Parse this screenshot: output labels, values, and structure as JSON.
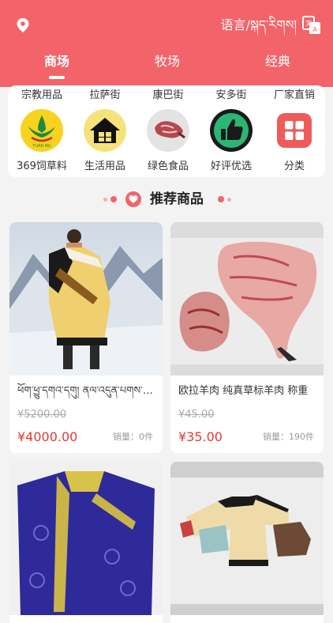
{
  "header": {
    "language_label": "语言/སྐད་རིགས།",
    "tabs": [
      {
        "label": "商场",
        "active": true
      },
      {
        "label": "牧场",
        "active": false
      },
      {
        "label": "经典",
        "active": false
      }
    ],
    "accent_color": "#f2646a"
  },
  "streets": [
    "宗教用品",
    "拉萨街",
    "康巴街",
    "安多街",
    "厂家直销"
  ],
  "categories": [
    {
      "label": "369饲草料",
      "icon": "yuan-mu-logo-icon",
      "logo_caption": "YUAN MU"
    },
    {
      "label": "生活用品",
      "icon": "house-icon"
    },
    {
      "label": "绿色食品",
      "icon": "meat-icon"
    },
    {
      "label": "好评优选",
      "icon": "thumbs-up-icon"
    },
    {
      "label": "分类",
      "icon": "grid-icon"
    }
  ],
  "section": {
    "title": "推荐商品"
  },
  "products": [
    {
      "name": "ཕོག་ཕྱུ་དགའ་དགུ། ནལ་འདུན་པགས་པ་ཤེལ་",
      "old_price": "¥5200.00",
      "price": "¥4000.00",
      "sales": "销量：0件",
      "image": "tibetan-robe-photo"
    },
    {
      "name": "欧拉羊肉    纯真草标羊肉  称重",
      "old_price": "¥45.00",
      "price": "¥35.00",
      "sales": "销量：190件",
      "image": "lamb-meat-photo"
    },
    {
      "name": "",
      "old_price": "",
      "price": "",
      "sales": "",
      "image": "blue-robe-photo"
    },
    {
      "name": "",
      "old_price": "",
      "price": "",
      "sales": "",
      "image": "children-robes-photo"
    }
  ]
}
